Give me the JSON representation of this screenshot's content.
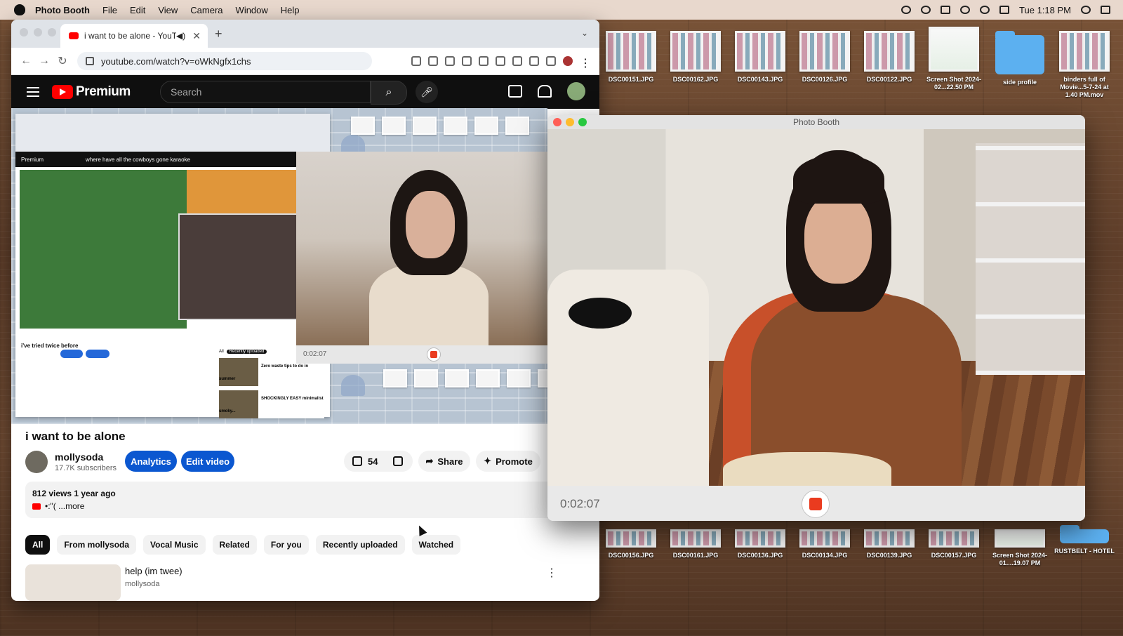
{
  "menubar": {
    "app": "Photo Booth",
    "items": [
      "File",
      "Edit",
      "View",
      "Camera",
      "Window",
      "Help"
    ],
    "clock": "Tue 1:18 PM"
  },
  "desktop": {
    "top_row": [
      {
        "label": "DSC00151.JPG"
      },
      {
        "label": "DSC00162.JPG"
      },
      {
        "label": "DSC00143.JPG"
      },
      {
        "label": "DSC00126.JPG"
      },
      {
        "label": "DSC00122.JPG"
      },
      {
        "label": "Screen Shot 2024-02...22.50 PM"
      },
      {
        "label": "side profile"
      },
      {
        "label": "binders full of Movie...5-7-24 at 1.40 PM.mov"
      }
    ],
    "bottom_row": [
      {
        "label": "DSC00156.JPG"
      },
      {
        "label": "DSC00161.JPG"
      },
      {
        "label": "DSC00136.JPG"
      },
      {
        "label": "DSC00134.JPG"
      },
      {
        "label": "DSC00139.JPG"
      },
      {
        "label": "DSC00157.JPG"
      },
      {
        "label": "Screen Shot 2024-01....19.07 PM"
      },
      {
        "label": "RUSTBELT - HOTEL"
      }
    ]
  },
  "browser": {
    "tab_title": "i want to be alone - YouTube",
    "url": "youtube.com/watch?v=oWkNgfx1chs",
    "yt_brand": "Premium",
    "search_placeholder": "Search",
    "nested": {
      "search_text": "where have all the cowboys gone karaoke",
      "video_title": "i've tried twice before",
      "chip_all": "All",
      "chip_recent": "Recently uploaded",
      "reco1": "Zero waste tips to do in summer",
      "reco2": "SHOCKINGLY EASY minimalist smoky...",
      "cam_time": "0:02:07"
    }
  },
  "video": {
    "title": "i want to be alone",
    "channel": "mollysoda",
    "subscribers": "17.7K subscribers",
    "analytics_label": "Analytics",
    "edit_label": "Edit video",
    "likes": "54",
    "share_label": "Share",
    "promote_label": "Promote",
    "views": "812 views  1 year ago",
    "desc_text": "•:\"(   ...more"
  },
  "chips": [
    "All",
    "From mollysoda",
    "Vocal Music",
    "Related",
    "For you",
    "Recently uploaded",
    "Watched"
  ],
  "reco": {
    "title": "help (im twee)",
    "channel": "mollysoda"
  },
  "photobooth": {
    "title": "Photo Booth",
    "timer": "0:02:07"
  },
  "colors": {
    "record_red": "#ea3b1f",
    "yt_red": "#ff0000",
    "yt_blue": "#0b57d0"
  }
}
